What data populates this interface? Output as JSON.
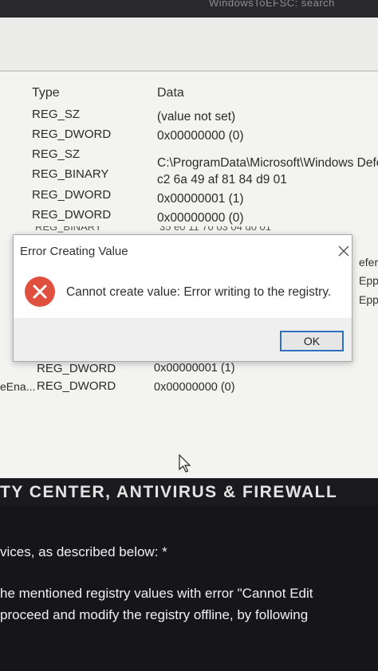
{
  "titlebar": {
    "text": "WindowsToEFSC: search"
  },
  "list": {
    "header_type": "Type",
    "header_data": "Data",
    "rows": [
      {
        "type": "REG_SZ",
        "data": "(value not set)"
      },
      {
        "type": "REG_DWORD",
        "data": "0x00000000 (0)"
      },
      {
        "type": "REG_SZ",
        "data": "C:\\ProgramData\\Microsoft\\Windows Defe"
      },
      {
        "type": "REG_BINARY",
        "data": "c2 6a 49 af 81 84 d9 01"
      },
      {
        "type": "REG_DWORD",
        "data": "0x00000001 (1)"
      },
      {
        "type": "REG_DWORD",
        "data": "0x00000000 (0)"
      }
    ],
    "clipped_row": {
      "type": "REG_BINARY",
      "data": "35 e0 11 70 03 04 d0 01"
    },
    "lower_rows": [
      {
        "name": "",
        "type": "REG_DWORD",
        "data": "0x00000001 (1)"
      },
      {
        "name": "eEna...",
        "type": "REG_DWORD",
        "data": "0x00000000 (0)"
      }
    ],
    "right_fragments": [
      "efer",
      "Epp",
      "Epp"
    ]
  },
  "dialog": {
    "title": "Error Creating Value",
    "message": "Cannot create value: Error writing to the registry.",
    "ok_label": "OK"
  },
  "article": {
    "banner": "TY CENTER, ANTIVIRUS & FIREWALL",
    "line1": "vices, as described below: *",
    "line2": "he mentioned registry values with error \"Cannot Edit",
    "line3": "proceed and modify the registry offline, by following"
  },
  "colors": {
    "error_red": "#e0503f",
    "ok_border": "#2f6fbf",
    "dark_bg": "#16161a"
  }
}
